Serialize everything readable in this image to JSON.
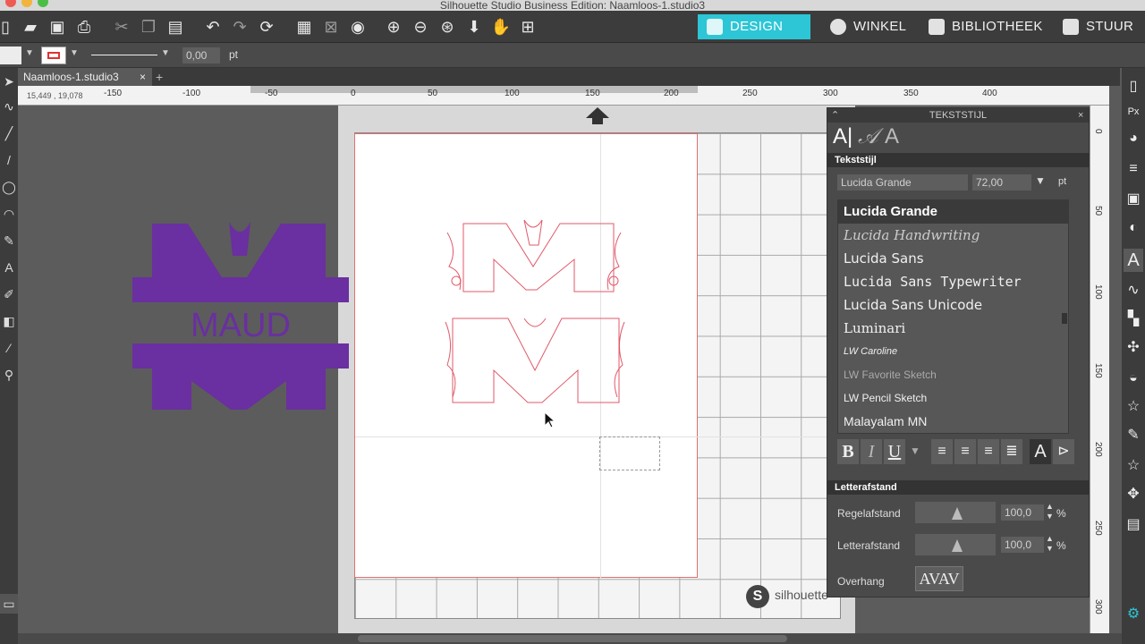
{
  "window": {
    "title": "Silhouette Studio Business Edition: Naamloos-1.studio3"
  },
  "nav_tabs": [
    {
      "label": "DESIGN"
    },
    {
      "label": "WINKEL"
    },
    {
      "label": "BIBLIOTHEEK"
    },
    {
      "label": "STUUR"
    }
  ],
  "options": {
    "line_width": "0,00",
    "unit": "pt"
  },
  "doc_tab": {
    "label": "Naamloos-1.studio3",
    "close": "×",
    "add": "+"
  },
  "coords": "15,449 , 19,078",
  "ruler_top": [
    "-150",
    "-100",
    "-50",
    "0",
    "50",
    "100",
    "150",
    "200",
    "250",
    "300",
    "350",
    "400"
  ],
  "ruler_right": [
    "0",
    "50",
    "100",
    "150",
    "200",
    "250",
    "300"
  ],
  "design": {
    "monogram_text": "MAUD",
    "monogram_color": "#6a2fa0",
    "cut_line_color": "#e05a6a"
  },
  "branding": {
    "mat_logo": "silhouette"
  },
  "panel": {
    "title": "TEKSTSTIJL",
    "section_style": "Tekststijl",
    "font_name": "Lucida Grande",
    "font_size": "72,00",
    "size_unit": "pt",
    "fonts": [
      "Lucida Grande",
      "Lucida Handwriting",
      "Lucida Sans",
      "Lucida Sans Typewriter",
      "Lucida Sans Unicode",
      "Luminari",
      "LW Caroline",
      "LW Favorite Sketch",
      "LW Pencil Sketch",
      "Malayalam MN"
    ],
    "section_spacing": "Letterafstand",
    "line_spacing_label": "Regelafstand",
    "line_spacing_value": "100,0",
    "letter_spacing_label": "Letterafstand",
    "letter_spacing_value": "100,0",
    "percent": "%",
    "overhang_label": "Overhang",
    "overhang_sample": "AVAV",
    "format_buttons": [
      "B",
      "I",
      "U"
    ]
  }
}
